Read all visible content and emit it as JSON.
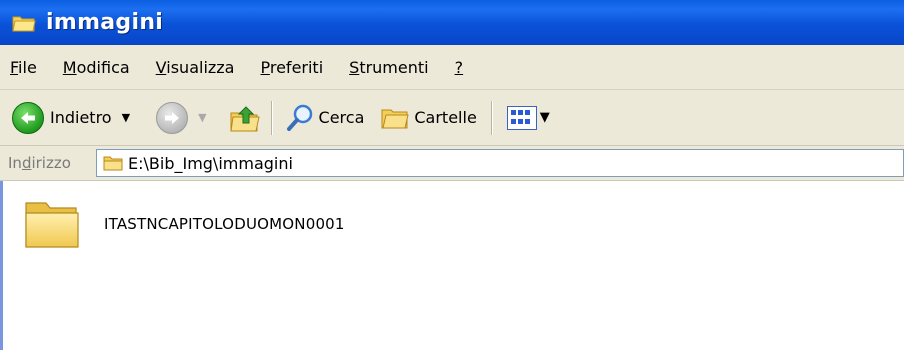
{
  "window": {
    "title": "immagini"
  },
  "menu": {
    "items": [
      {
        "ul": "F",
        "rest": "ile"
      },
      {
        "ul": "M",
        "rest": "odifica"
      },
      {
        "ul": "V",
        "rest": "isualizza"
      },
      {
        "ul": "P",
        "rest": "referiti"
      },
      {
        "ul": "S",
        "rest": "trumenti"
      },
      {
        "ul": "?",
        "rest": ""
      }
    ]
  },
  "toolbar": {
    "back_label": "Indietro",
    "search_label": "Cerca",
    "folders_label": "Cartelle"
  },
  "address": {
    "label_pre": "In",
    "label_ul": "d",
    "label_post": "irizzo",
    "path": "E:\\Bib_Img\\immagini"
  },
  "content": {
    "items": [
      {
        "name": "ITASTNCAPITOLODUOMON0001"
      }
    ]
  }
}
